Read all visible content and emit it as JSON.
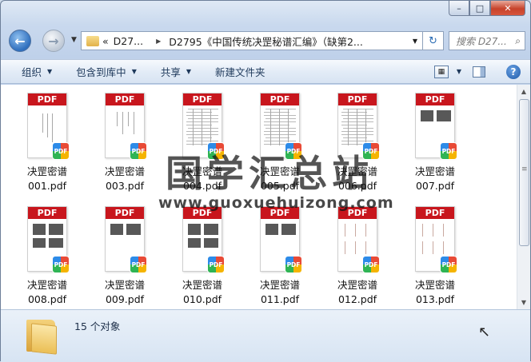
{
  "window": {
    "caption_buttons": {
      "minimize": "–",
      "maximize": "□",
      "close": "✕"
    }
  },
  "nav": {
    "breadcrumb_chevrons": "«",
    "breadcrumb_root": "D27...",
    "breadcrumb_current": "D2795《中国传统决罡秘谱汇编》（缺第2...",
    "search_placeholder": "搜索 D27..."
  },
  "toolbar": {
    "organize": "组织",
    "include_library": "包含到库中",
    "share": "共享",
    "new_folder": "新建文件夹"
  },
  "files": [
    {
      "line1": "决罡密谱",
      "line2": "001.pdf",
      "style": "cover"
    },
    {
      "line1": "决罡密谱",
      "line2": "003.pdf",
      "style": "text"
    },
    {
      "line1": "决罡密谱",
      "line2": "004.pdf",
      "style": "table"
    },
    {
      "line1": "决罡密谱",
      "line2": "005.pdf",
      "style": "table"
    },
    {
      "line1": "决罡密谱",
      "line2": "006.pdf",
      "style": "table"
    },
    {
      "line1": "决罡密谱",
      "line2": "007.pdf",
      "style": "photos"
    },
    {
      "line1": "决罡密谱",
      "line2": "008.pdf",
      "style": "photos"
    },
    {
      "line1": "决罡密谱",
      "line2": "009.pdf",
      "style": "photos"
    },
    {
      "line1": "决罡密谱",
      "line2": "010.pdf",
      "style": "photos"
    },
    {
      "line1": "决罡密谱",
      "line2": "011.pdf",
      "style": "photos"
    },
    {
      "line1": "决罡密谱",
      "line2": "012.pdf",
      "style": "figures"
    },
    {
      "line1": "决罡密谱",
      "line2": "013.pdf",
      "style": "figures"
    }
  ],
  "pdf_band_label": "PDF",
  "pdf_badge_label": "PDF",
  "watermark": {
    "title": "国学汇总站",
    "url": "www.guoxuehuizong.com"
  },
  "status": {
    "item_count": "15 个对象"
  },
  "colors": {
    "pdf_band": "#c8161d",
    "window_chrome": "#c9d9ee",
    "accent": "#2f6fbe"
  }
}
